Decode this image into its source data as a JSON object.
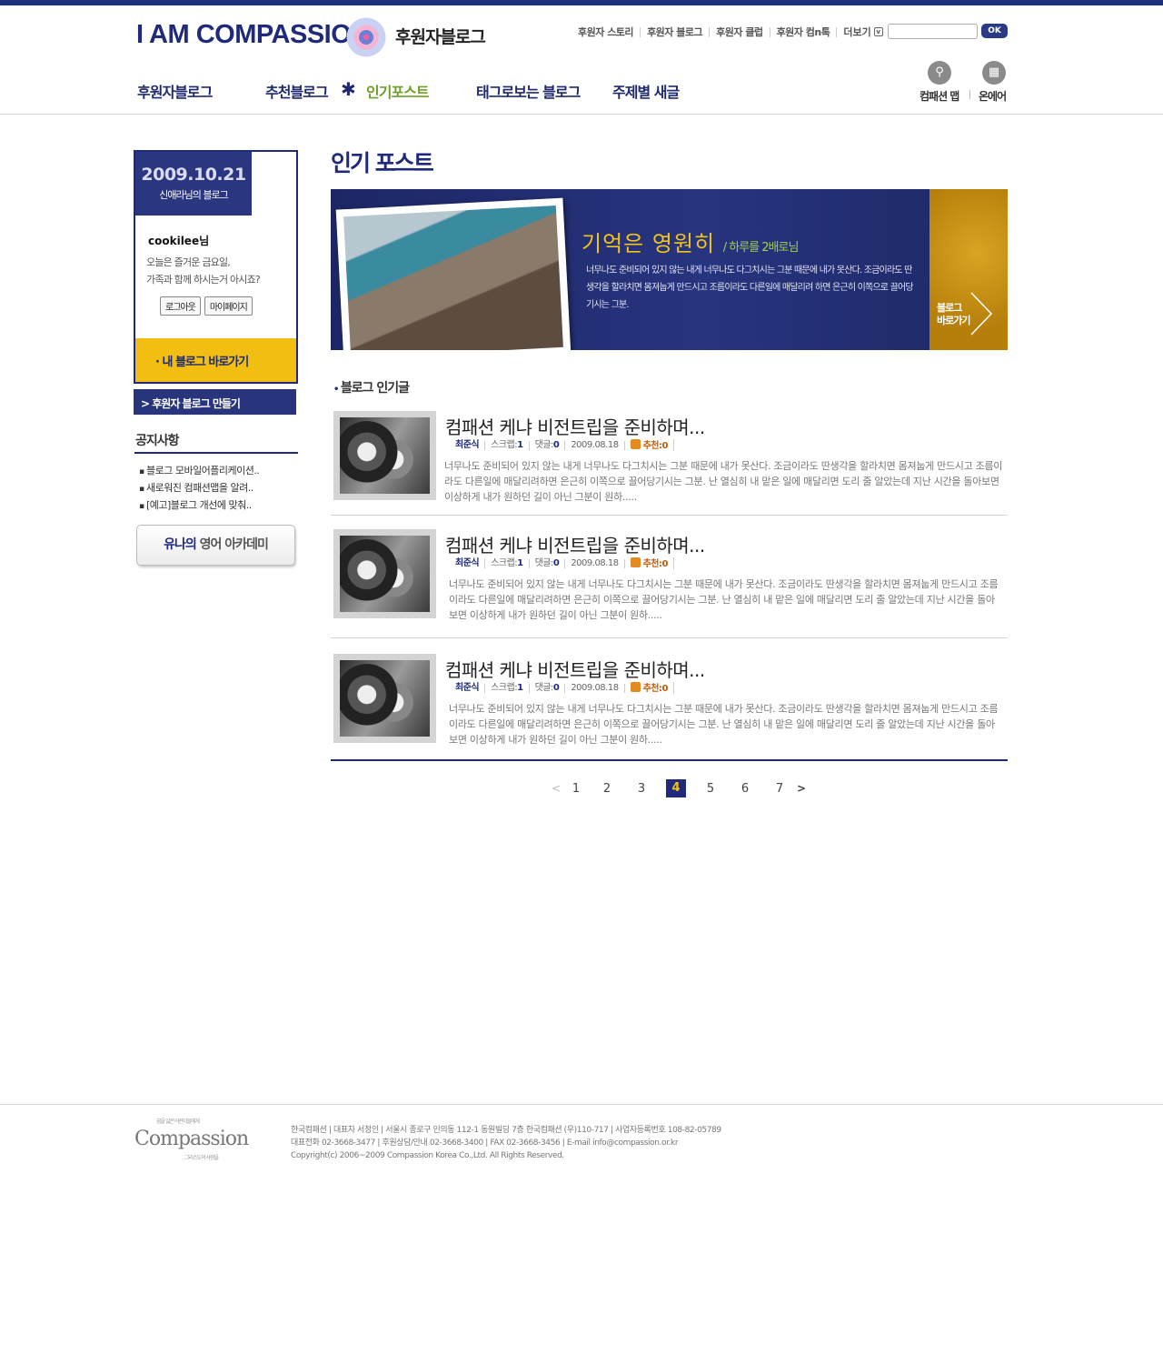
{
  "header": {
    "logo": "I AM COMPASSION",
    "logo_sub": "후원자블로그",
    "util_links": [
      "후원자 스토리",
      "후원자 블로그",
      "후원자 클럽",
      "후원자 컴n톡"
    ],
    "more": "더보기",
    "search_placeholder": "",
    "search_button": "OK",
    "gnb": [
      "후원자블로그",
      "추천블로그",
      "인기포스트",
      "태그로보는 블로그",
      "주제별 새글"
    ],
    "right_icons": [
      {
        "label": "컴패션 맵",
        "icon": "search-icon"
      },
      {
        "label": "온에어",
        "icon": "gift-icon"
      }
    ]
  },
  "sidebar": {
    "date": "2009.10.21",
    "blog_owner": "신애라님의 블로그",
    "user": "cookilee님",
    "greeting_line1": "오늘은 즐거운 금요일,",
    "greeting_line2": "가족과 함께 하시는거 아시죠?",
    "logout": "로그아웃",
    "mypage": "마이페이지",
    "my_blog": "· 내 블로그 바로가기",
    "make_blog": "> 후원자 블로그 만들기",
    "notice_title": "공지사항",
    "notices": [
      "블로그 모바일어플리케이션..",
      "새로워진 컴패션맵을 알려..",
      "[예고]블로그 개선에 맞춰.."
    ],
    "academy_a": "유나의",
    "academy_b": "영어 아카데미"
  },
  "main": {
    "title": "인기 포스트",
    "banner": {
      "headline": "기억은 영원히",
      "headline_sub": "/ 하루를 2배로님",
      "text": "너무나도 준비되어 있지 않는 내게 너무나도 다그치시는 그분 때문에 내가 못산다. 조금이라도 딴생각을 할라치면 몸져눕게 만드시고 조름이라도 다른일에 매달리려 하면 은근히 이쪽으로 끌어당기시는 그분.",
      "go_line1": "블로그",
      "go_line2": "바로가기"
    },
    "section_title": "블로그 인기글",
    "posts": [
      {
        "title": "컴패션 케냐 비전트립을 준비하며...",
        "author": "최준식",
        "scrap_label": "스크랩:",
        "scrap": "1",
        "comment_label": "댓글:",
        "comments": "0",
        "date": "2009.08.18",
        "recommend": "추천:0",
        "excerpt": "너무나도 준비되어 있지 않는 내게 너무나도 다그치시는 그분 때문에 내가 못산다. 조금이라도 딴생각을 할라치면 몸져눕게 만드시고 조름이라도 다른일에 매달리려하면 은근히 이쪽으로 끌어당기시는 그분. 난 열심히 내 맡은 일에 매달리면 도리 줄 알았는데 지난 시간을 돌아보면 이상하게 내가 원하던 길이 아닌 그분이 원하....."
      },
      {
        "title": "컴패션 케냐 비전트립을 준비하며...",
        "author": "최준식",
        "scrap_label": "스크랩:",
        "scrap": "1",
        "comment_label": "댓글:",
        "comments": "0",
        "date": "2009.08.18",
        "recommend": "추천:0",
        "excerpt": "너무나도 준비되어 있지 않는 내게 너무나도 다그치시는 그분 때문에 내가 못산다. 조금이라도 딴생각을 할라치면 몸져눕게 만드시고 조름이라도 다른일에 매달리려하면 은근히 이쪽으로 끌어당기시는 그분. 난 열심히 내 맡은 일에 매달리면 도리 줄 알았는데 지난 시간을 돌아보면 이상하게 내가 원하던 길이 아닌 그분이 원하....."
      },
      {
        "title": "컴패션 케냐 비전트립을 준비하며...",
        "author": "최준식",
        "scrap_label": "스크랩:",
        "scrap": "1",
        "comment_label": "댓글:",
        "comments": "0",
        "date": "2009.08.18",
        "recommend": "추천:0",
        "excerpt": "너무나도 준비되어 있지 않는 내게 너무나도 다그치시는 그분 때문에 내가 못산다. 조금이라도 딴생각을 할라치면 몸져눕게 만드시고 조름이라도 다른일에 매달리려하면 은근히 이쪽으로 끌어당기시는 그분. 난 열심히 내 맡은 일에 매달리면 도리 줄 알았는데 지난 시간을 돌아보면 이상하게 내가 원하던 길이 아닌 그분이 원하....."
      }
    ],
    "pager": {
      "prev": "<",
      "pages": [
        "1",
        "2",
        "3",
        "4",
        "5",
        "6",
        "7"
      ],
      "current": "4",
      "next": ">"
    }
  },
  "footer": {
    "logo": "Compassion",
    "logo_tag1": "꿈을 잃은 어린이들에게",
    "logo_tag2": "그리스도의 사랑을",
    "line1": "한국컴패션 | 대표자 서정인 | 서울시 종로구 인의동 112-1 동원빌딩 7층 한국컴패션 (우)110-717 | 사업자등록번호 108-82-05789",
    "line2": "대표전화 02-3668-3477 | 후원상담/안내 02-3668-3400 | FAX 02-3668-3456 | E-mail info@compassion.or.kr",
    "line3": "Copyright(c) 2006~2009 Compassion Korea Co.,Ltd. All Rights Reserved."
  },
  "colors": {
    "brand_navy": "#1f2a7c",
    "accent_yellow": "#f1be11",
    "active_green": "#6fa12a",
    "recommend_orange": "#c75a00"
  }
}
